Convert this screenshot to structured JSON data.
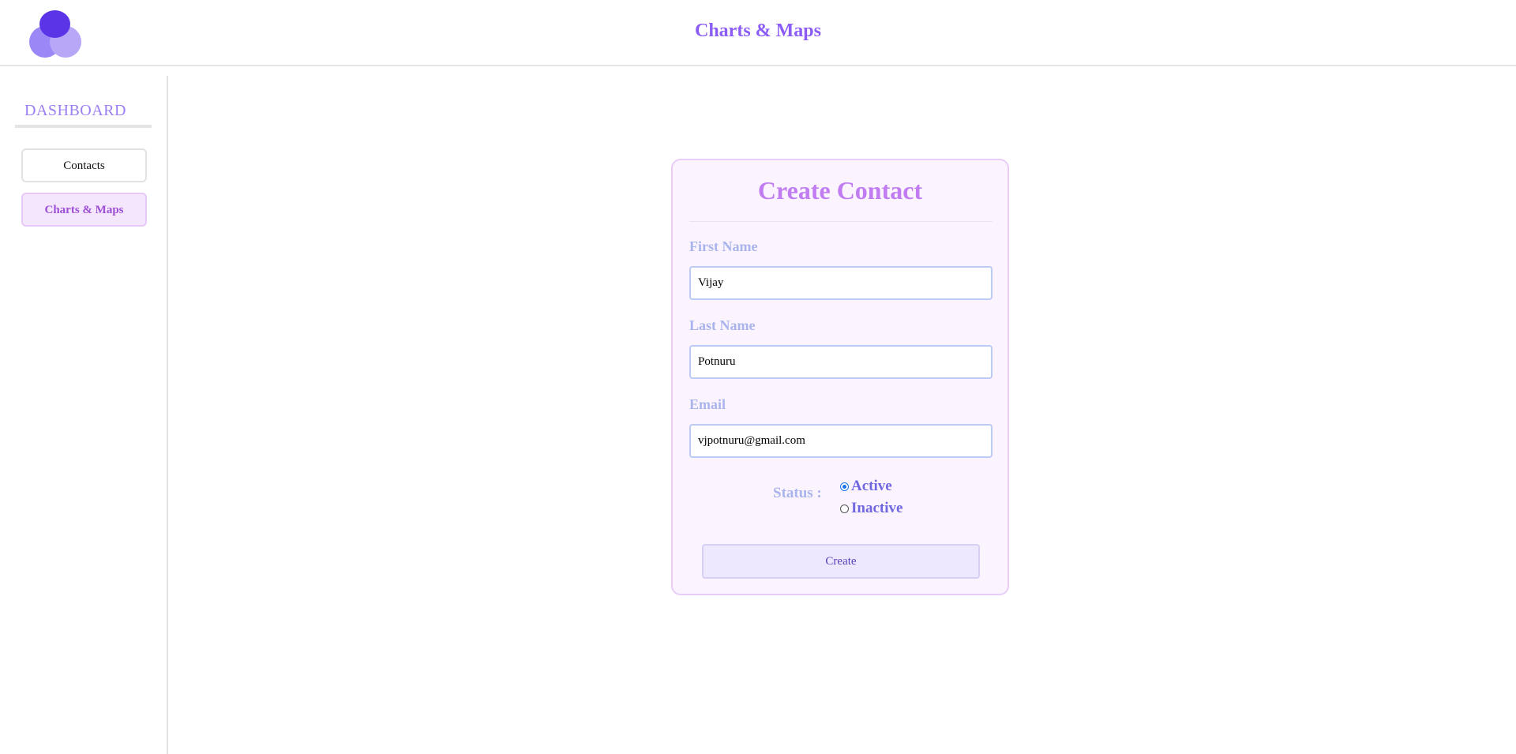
{
  "header": {
    "title": "Charts & Maps",
    "logo_icon": "three-circles-logo-icon"
  },
  "sidebar": {
    "title": "DASHBOARD",
    "items": [
      {
        "label": "Contacts",
        "active": false
      },
      {
        "label": "Charts & Maps",
        "active": true
      }
    ]
  },
  "form": {
    "title": "Create Contact",
    "first_name": {
      "label": "First Name",
      "value": "Vijay"
    },
    "last_name": {
      "label": "Last Name",
      "value": "Potnuru"
    },
    "email": {
      "label": "Email",
      "value": "vjpotnuru@gmail.com"
    },
    "status": {
      "label": "Status :",
      "options": [
        {
          "label": "Active",
          "selected": true
        },
        {
          "label": "Inactive",
          "selected": false
        }
      ]
    },
    "submit_label": "Create"
  },
  "colors": {
    "accent": "#8b5cf6",
    "card_bg": "#fbf4fe",
    "label": "#a9b4ec",
    "radio_text": "#6f66e0"
  }
}
